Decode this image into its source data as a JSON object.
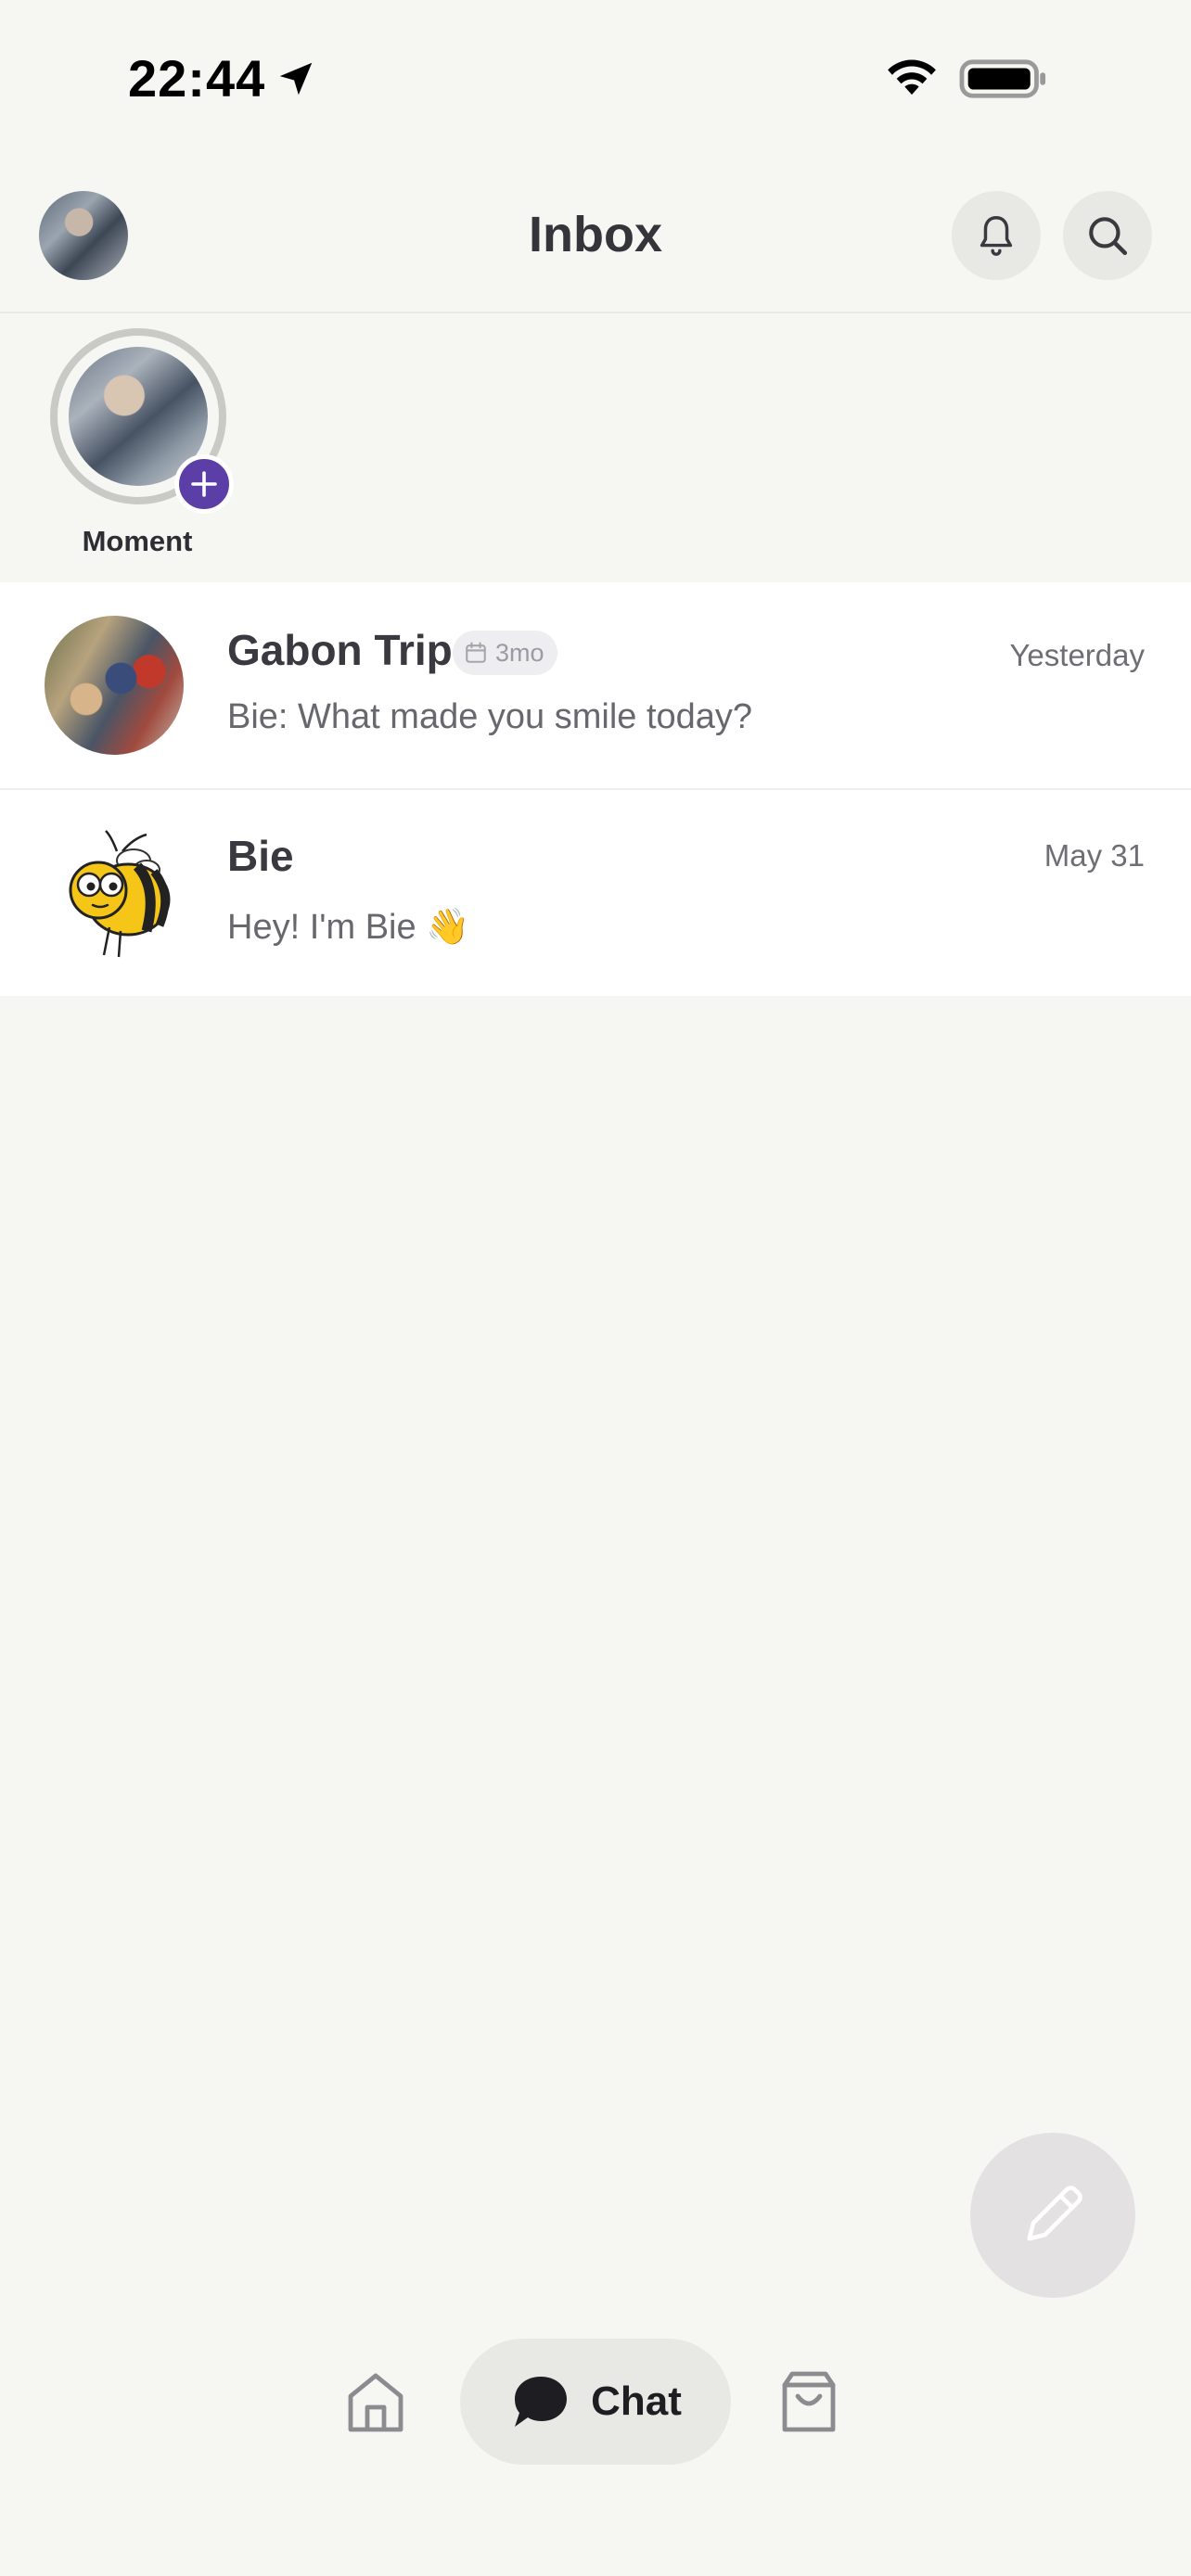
{
  "status_bar": {
    "time": "22:44",
    "icons": [
      "location-arrow-icon",
      "wifi-icon",
      "battery-icon"
    ]
  },
  "header": {
    "title": "Inbox",
    "actions": [
      "bell-icon",
      "search-icon"
    ]
  },
  "moments": {
    "label": "Moment",
    "add_icon": "plus-icon"
  },
  "conversations": [
    {
      "title": "Gabon Trip",
      "badge": "3mo",
      "badge_icon": "calendar-icon",
      "time": "Yesterday",
      "preview": "Bie: What made you smile today?"
    },
    {
      "title": "Bie",
      "time": "May 31",
      "preview": "Hey! I'm Bie 👋"
    }
  ],
  "compose": {
    "icon": "pencil-icon"
  },
  "bottom_nav": {
    "items": [
      {
        "icon": "home-icon"
      },
      {
        "icon": "chat-bubble-icon",
        "label": "Chat",
        "active": true
      },
      {
        "icon": "shopping-bag-icon"
      }
    ]
  },
  "colors": {
    "background": "#f6f6f3",
    "accent": "#5b3fa6",
    "text_primary": "#35343a",
    "text_secondary": "#68676d"
  }
}
